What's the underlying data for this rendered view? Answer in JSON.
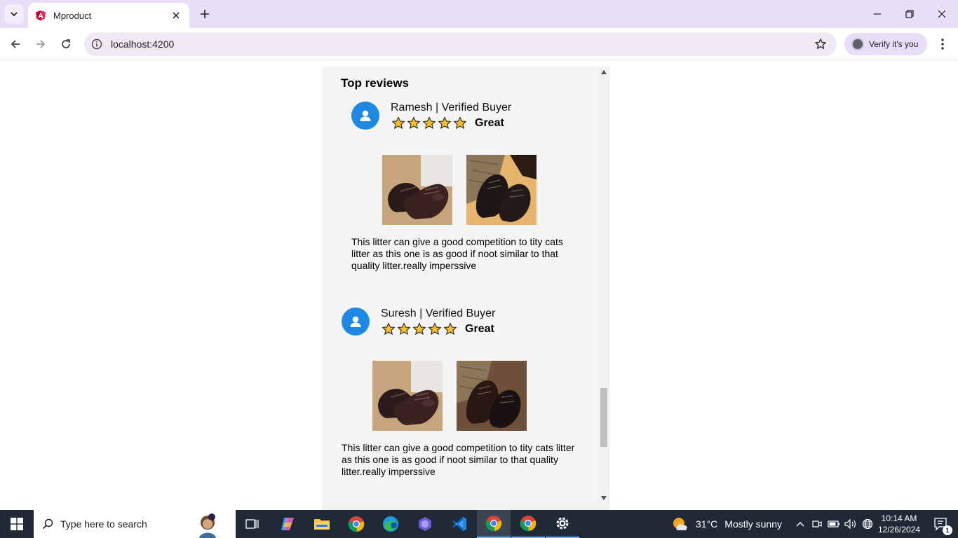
{
  "browser": {
    "tab_title": "Mproduct",
    "url": "localhost:4200",
    "profile_label": "Verify it's you",
    "accent": "#e8def8"
  },
  "reviews": {
    "section_title": "Top reviews",
    "items": [
      {
        "reviewer": "Ramesh | Verified Buyer",
        "rating": 5,
        "rating_title": "Great",
        "text": "This litter can give a good competition to tity cats litter as this one is as good if noot similar to that quality litter.really imperssive"
      },
      {
        "reviewer": "Suresh | Verified Buyer",
        "rating": 5,
        "rating_title": "Great",
        "text": "This litter can give a good competition to tity cats litter as this one is as good if noot similar to that quality litter.really imperssive"
      }
    ],
    "star_color": "#f6c02c",
    "avatar_color": "#1e88e5"
  },
  "taskbar": {
    "search_placeholder": "Type here to search",
    "weather_temp": "31°C",
    "weather_desc": "Mostly sunny",
    "time": "10:14 AM",
    "date": "12/26/2024",
    "notification_count": "1"
  }
}
